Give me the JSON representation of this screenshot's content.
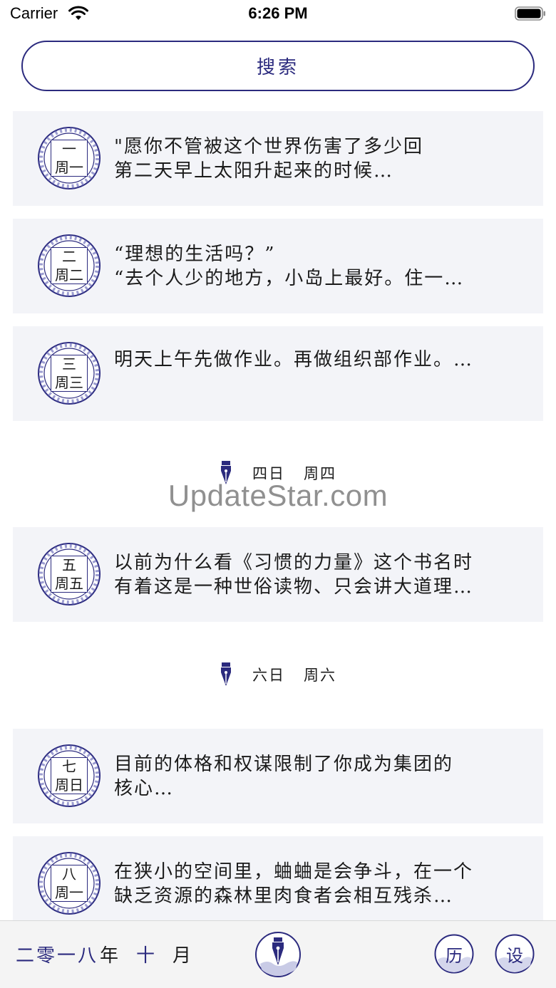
{
  "status_bar": {
    "carrier": "Carrier",
    "time": "6:26 PM"
  },
  "search": {
    "label": "搜索"
  },
  "entries": [
    {
      "day": "一",
      "weekday": "周一",
      "line1": "\"愿你不管被这个世界伤害了多少回",
      "line2": "第二天早上太阳升起来的时候…"
    },
    {
      "day": "二",
      "weekday": "周二",
      "line1": "“理想的生活吗？”",
      "line2": "“去个人少的地方，小岛上最好。住一…"
    },
    {
      "day": "三",
      "weekday": "周三",
      "line1": "明天上午先做作业。再做组织部作业。…",
      "line2": ""
    },
    {
      "day": "五",
      "weekday": "周五",
      "line1": "以前为什么看《习惯的力量》这个书名时",
      "line2": "有着这是一种世俗读物、只会讲大道理…"
    },
    {
      "day": "七",
      "weekday": "周日",
      "line1": "目前的体格和权谋限制了你成为集团的",
      "line2": "核心…"
    },
    {
      "day": "八",
      "weekday": "周一",
      "line1": "在狭小的空间里，蛐蛐是会争斗，在一个",
      "line2": "缺乏资源的森林里肉食者会相互残杀…"
    }
  ],
  "separators": [
    {
      "day": "四日",
      "weekday": "周四"
    },
    {
      "day": "六日",
      "weekday": "周六"
    }
  ],
  "watermark": "UpdateStar.com",
  "bottom_bar": {
    "year": "二零一八",
    "year_suffix": "年",
    "month": "十",
    "month_suffix": "月",
    "calendar_label": "历",
    "settings_label": "设"
  },
  "colors": {
    "accent": "#2b2a7e",
    "card_bg": "#f3f4f8",
    "bar_bg": "#f4f4f4"
  },
  "icons": [
    "wifi-icon",
    "battery-icon",
    "pen-nib-icon",
    "porcelain-badge-icon"
  ]
}
